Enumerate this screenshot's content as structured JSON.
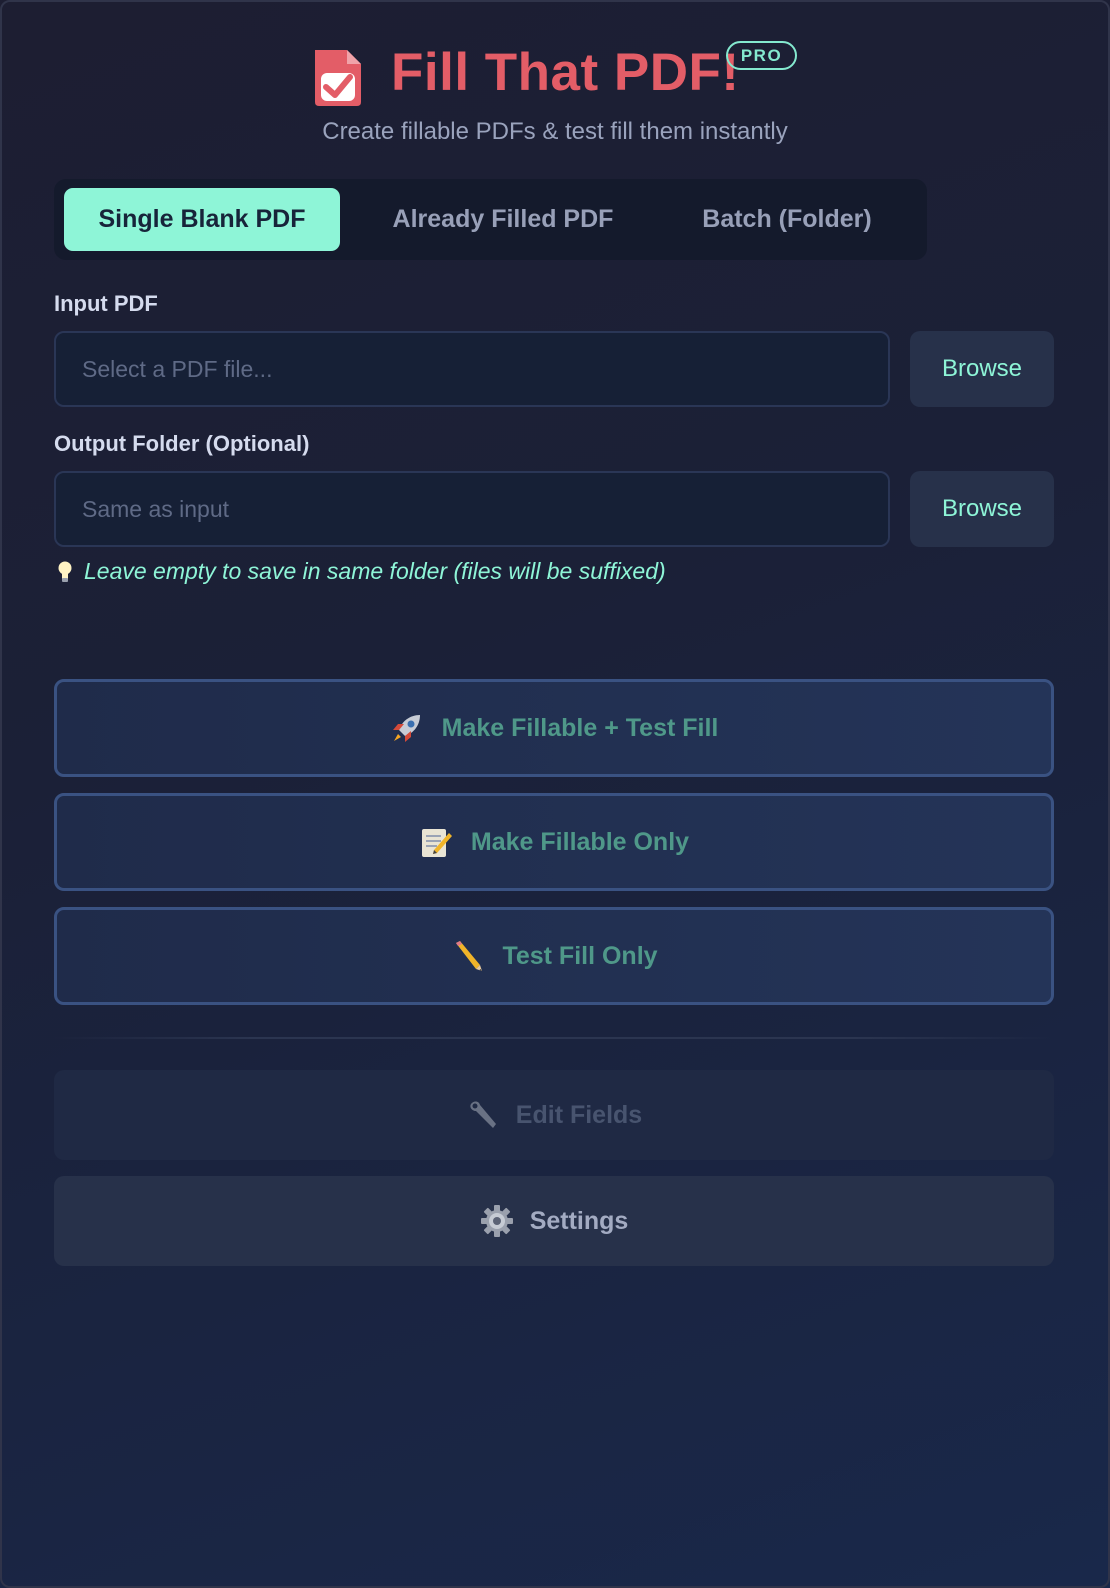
{
  "header": {
    "title": "Fill That PDF!",
    "badge": "PRO",
    "subtitle": "Create fillable PDFs & test fill them instantly",
    "logo_icon": "checked-document-icon"
  },
  "tabs": [
    {
      "label": "Single Blank PDF",
      "active": true
    },
    {
      "label": "Already Filled PDF",
      "active": false
    },
    {
      "label": "Batch (Folder)",
      "active": false
    }
  ],
  "input_pdf": {
    "label": "Input PDF",
    "value": "",
    "placeholder": "Select a PDF file...",
    "browse_label": "Browse"
  },
  "output_folder": {
    "label": "Output Folder (Optional)",
    "value": "",
    "placeholder": "Same as input",
    "browse_label": "Browse"
  },
  "hint": {
    "icon": "lightbulb-icon",
    "text": "Leave empty to save in same folder (files will be suffixed)"
  },
  "actions": [
    {
      "label": "Make Fillable + Test Fill",
      "icon": "rocket-icon"
    },
    {
      "label": "Make Fillable Only",
      "icon": "memo-icon"
    },
    {
      "label": "Test Fill Only",
      "icon": "pencil-icon"
    }
  ],
  "utilities": {
    "edit_fields": {
      "label": "Edit Fields",
      "icon": "wrench-icon",
      "enabled": false
    },
    "settings": {
      "label": "Settings",
      "icon": "gear-icon",
      "enabled": true
    }
  },
  "colors": {
    "title": "#e35d67",
    "accent": "#8ef5d7",
    "action_text": "#4f9889",
    "background": "#1b2037"
  }
}
